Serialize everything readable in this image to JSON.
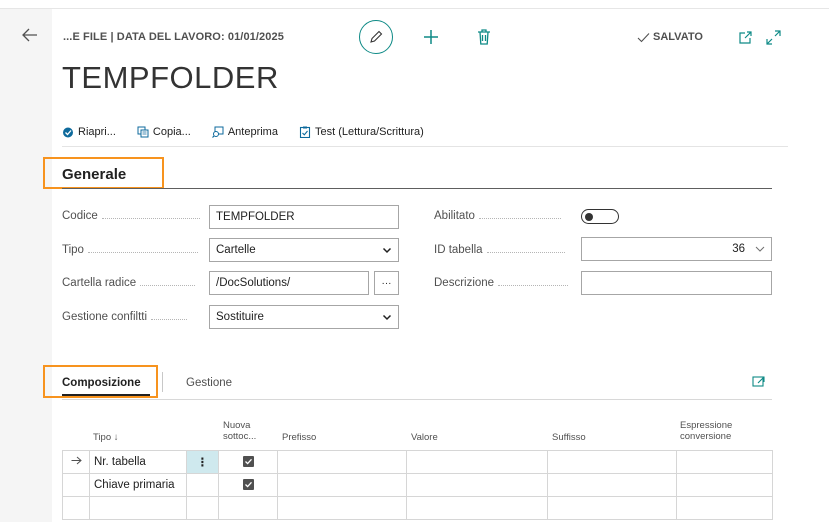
{
  "header": {
    "breadcrumb": "...E FILE | DATA DEL LAVORO: 01/01/2025",
    "saved_label": "SALVATO",
    "title": "TEMPFOLDER"
  },
  "actions": [
    {
      "label": "Riapri...",
      "icon": "reopen-icon"
    },
    {
      "label": "Copia...",
      "icon": "copy-icon"
    },
    {
      "label": "Anteprima",
      "icon": "preview-icon"
    },
    {
      "label": "Test (Lettura/Scrittura)",
      "icon": "test-icon"
    }
  ],
  "general": {
    "section_title": "Generale",
    "codice": {
      "label": "Codice",
      "value": "TEMPFOLDER"
    },
    "tipo": {
      "label": "Tipo",
      "value": "Cartelle"
    },
    "cartella_radice": {
      "label": "Cartella radice",
      "value": "/DocSolutions/",
      "lookup": "···"
    },
    "gestione_conflitti": {
      "label": "Gestione confiltti",
      "value": "Sostituire"
    },
    "abilitato": {
      "label": "Abilitato",
      "value": false
    },
    "id_tabella": {
      "label": "ID tabella",
      "value": "36"
    },
    "descrizione": {
      "label": "Descrizione",
      "value": ""
    }
  },
  "tabs": {
    "active": "Composizione",
    "inactive": "Gestione"
  },
  "grid": {
    "headers": {
      "tipo": "Tipo ↓",
      "nuova_line1": "Nuova",
      "nuova_line2": "sottoc...",
      "prefisso": "Prefisso",
      "valore": "Valore",
      "suffisso": "Suffisso",
      "espressione_line1": "Espressione",
      "espressione_line2": "conversione"
    },
    "rows": [
      {
        "tipo": "Nr. tabella",
        "nuova": true,
        "current": true
      },
      {
        "tipo": "Chiave primaria",
        "nuova": true,
        "current": false
      }
    ]
  },
  "colors": {
    "accent": "#0e8a86",
    "highlight": "#f7931e"
  }
}
